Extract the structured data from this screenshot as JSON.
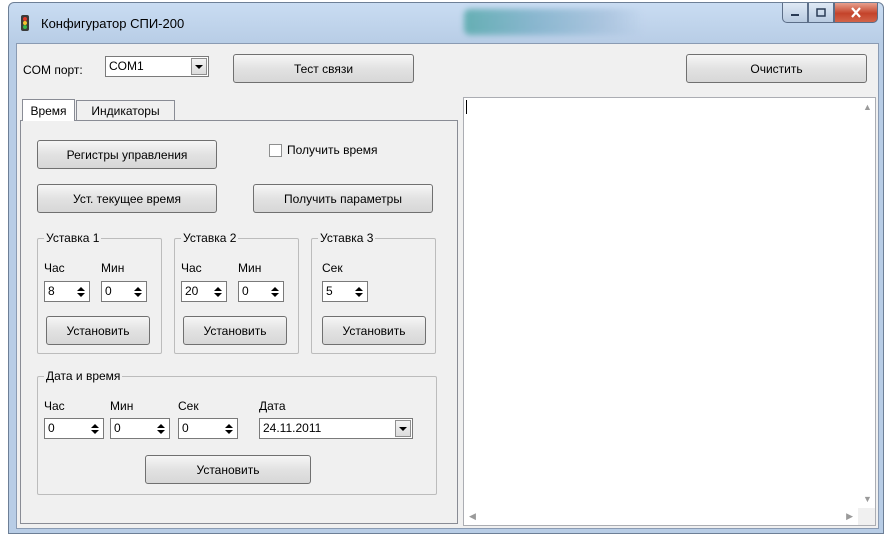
{
  "window": {
    "title": "Конфигуратор СПИ-200"
  },
  "toolbar": {
    "com_label": "COM порт:",
    "com_value": "COM1",
    "test_label": "Тест связи",
    "clear_label": "Очистить"
  },
  "tabs": [
    {
      "label": "Время",
      "active": true
    },
    {
      "label": "Индикаторы",
      "active": false
    }
  ],
  "time_tab": {
    "registers_label": "Регистры управления",
    "get_time_label": "Получить время",
    "get_time_checked": false,
    "set_current_label": "Уст. текущее время",
    "get_params_label": "Получить параметры",
    "setpoint1": {
      "title": "Уставка 1",
      "hour_label": "Час",
      "min_label": "Мин",
      "hour": "8",
      "min": "0",
      "set_label": "Установить"
    },
    "setpoint2": {
      "title": "Уставка 2",
      "hour_label": "Час",
      "min_label": "Мин",
      "hour": "20",
      "min": "0",
      "set_label": "Установить"
    },
    "setpoint3": {
      "title": "Уставка 3",
      "sec_label": "Сек",
      "sec": "5",
      "set_label": "Установить"
    },
    "datetime": {
      "title": "Дата и время",
      "hour_label": "Час",
      "min_label": "Мин",
      "sec_label": "Сек",
      "date_label": "Дата",
      "hour": "0",
      "min": "0",
      "sec": "0",
      "date": "24.11.2011",
      "set_label": "Установить"
    }
  },
  "icons": {
    "app": "traffic-light-icon",
    "minimize": "minimize-icon",
    "maximize": "maximize-icon",
    "close": "close-icon"
  },
  "colors": {
    "titlebar": "#b8cde6",
    "close_button": "#c4432a",
    "client_bg": "#f0f0f0"
  }
}
